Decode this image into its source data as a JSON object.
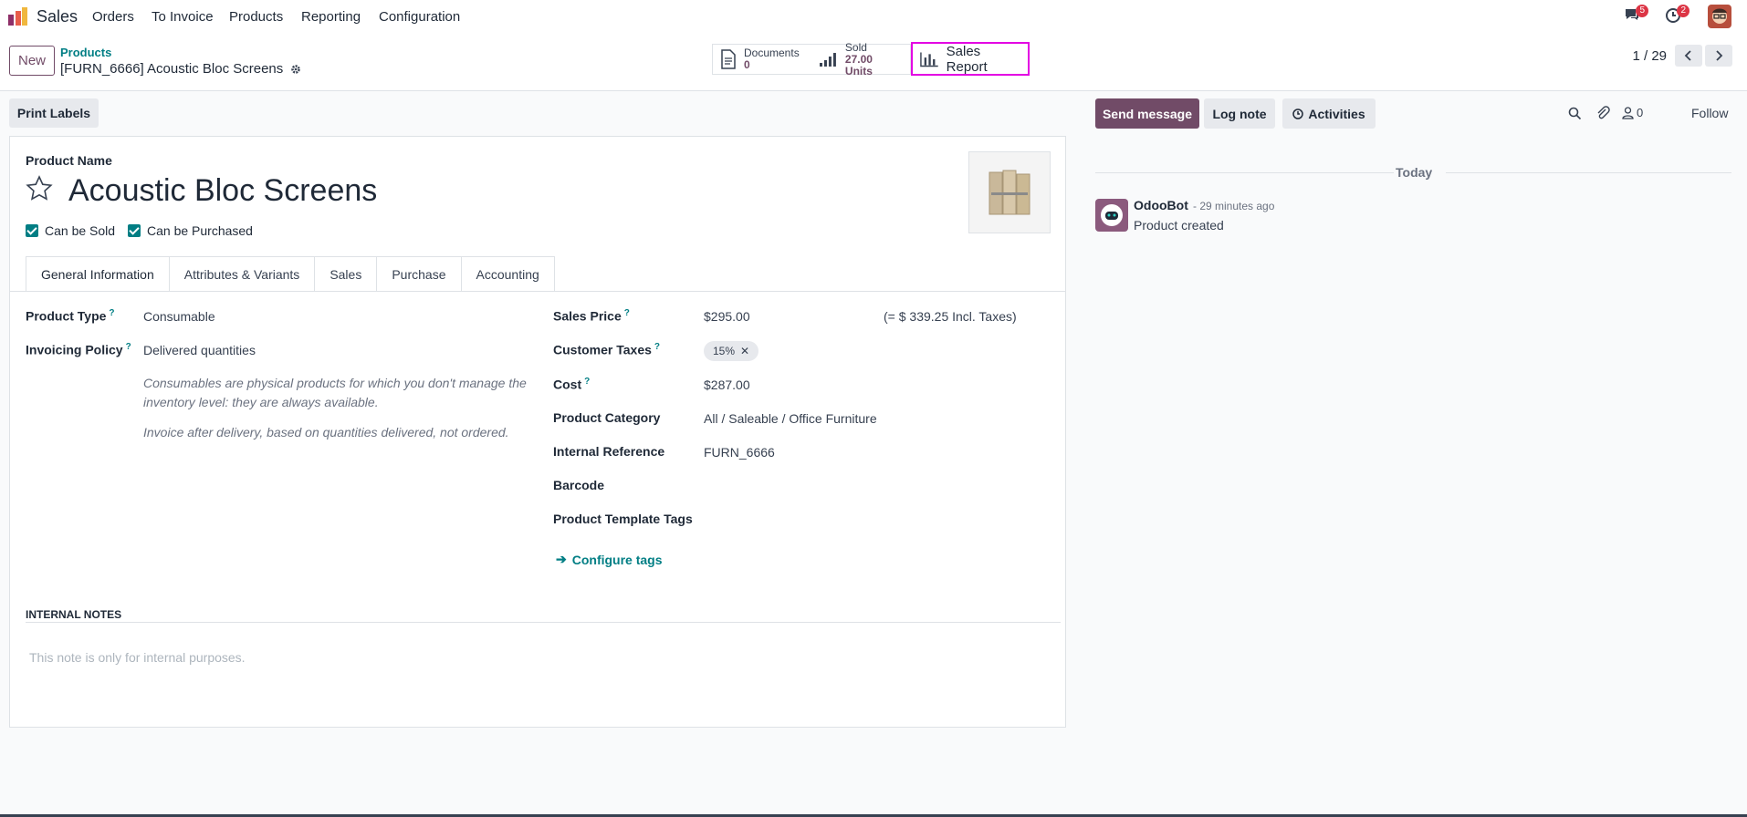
{
  "nav": {
    "app_name": "Sales",
    "menu": [
      "Orders",
      "To Invoice",
      "Products",
      "Reporting",
      "Configuration"
    ],
    "messages_count": "5",
    "activities_count": "2"
  },
  "control_panel": {
    "new_label": "New",
    "breadcrumb_parent": "Products",
    "breadcrumb_current": "[FURN_6666] Acoustic Bloc Screens",
    "smart_buttons": {
      "documents_label": "Documents",
      "documents_value": "0",
      "sold_label": "Sold",
      "sold_value": "27.00 Units",
      "sales_report_label": "Sales Report"
    },
    "pager": "1 / 29"
  },
  "actions": {
    "print_labels": "Print Labels"
  },
  "product": {
    "name_label": "Product Name",
    "name": "Acoustic Bloc Screens",
    "can_be_sold": "Can be Sold",
    "can_be_purchased": "Can be Purchased"
  },
  "tabs": [
    "General Information",
    "Attributes & Variants",
    "Sales",
    "Purchase",
    "Accounting"
  ],
  "general": {
    "product_type_label": "Product Type",
    "product_type": "Consumable",
    "invoicing_policy_label": "Invoicing Policy",
    "invoicing_policy": "Delivered quantities",
    "help_1a": "Consumables are physical products for which you don't manage the",
    "help_1b": "inventory level: they are always available.",
    "help_2": "Invoice after delivery, based on quantities delivered, not ordered.",
    "sales_price_label": "Sales Price",
    "sales_price": "$295.00",
    "incl_taxes": "(= $ 339.25 Incl. Taxes)",
    "customer_taxes_label": "Customer Taxes",
    "tax_tag": "15%",
    "cost_label": "Cost",
    "cost": "$287.00",
    "category_label": "Product Category",
    "category": "All / Saleable / Office Furniture",
    "internal_ref_label": "Internal Reference",
    "internal_ref": "FURN_6666",
    "barcode_label": "Barcode",
    "tags_label": "Product Template Tags",
    "configure_tags": "Configure tags"
  },
  "notes": {
    "title": "INTERNAL NOTES",
    "placeholder": "This note is only for internal purposes."
  },
  "chatter": {
    "send_message": "Send message",
    "log_note": "Log note",
    "activities": "Activities",
    "followers_count": "0",
    "follow": "Follow",
    "today": "Today",
    "author": "OdooBot",
    "time": "- 29 minutes ago",
    "message": "Product created"
  },
  "colors": {
    "accent": "#714b67",
    "teal": "#017e84",
    "highlight": "#e300e3"
  }
}
